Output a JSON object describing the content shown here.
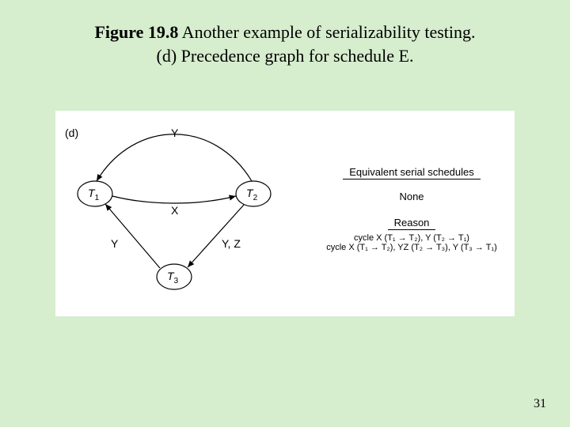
{
  "title": {
    "figure_prefix": "Figure 19.8",
    "line1_rest": "  Another example of serializability testing.",
    "line2": "(d) Precedence graph for schedule E."
  },
  "panel": {
    "subfigure_label": "(d)",
    "nodes": {
      "T1": "T",
      "T1_sub": "1",
      "T2": "T",
      "T2_sub": "2",
      "T3": "T",
      "T3_sub": "3"
    },
    "edge_labels": {
      "top_Y": "Y",
      "mid_X": "X",
      "left_Y": "Y",
      "right_YZ": "Y, Z"
    },
    "side": {
      "equiv_header": "Equivalent serial schedules",
      "equiv_value": "None",
      "reason_header": "Reason",
      "cycle1_prefix": "cycle ",
      "cycle1_body": "X (T₁ → T₂), Y (T₂ → T₁)",
      "cycle2_prefix": "cycle ",
      "cycle2_body": "X (T₁ → T₂), YZ (T₂ → T₃), Y (T₃ → T₁)"
    }
  },
  "page_number": "31",
  "chart_data": {
    "type": "table",
    "description": "Precedence (serialization) graph for schedule E",
    "nodes": [
      "T1",
      "T2",
      "T3"
    ],
    "edges": [
      {
        "from": "T1",
        "to": "T2",
        "label": "X"
      },
      {
        "from": "T2",
        "to": "T1",
        "label": "Y"
      },
      {
        "from": "T2",
        "to": "T3",
        "label": "Y, Z"
      },
      {
        "from": "T3",
        "to": "T1",
        "label": "Y"
      }
    ],
    "equivalent_serial_schedules": "None",
    "cycles": [
      [
        "X (T1→T2)",
        "Y (T2→T1)"
      ],
      [
        "X (T1→T2)",
        "YZ (T2→T3)",
        "Y (T3→T1)"
      ]
    ]
  }
}
